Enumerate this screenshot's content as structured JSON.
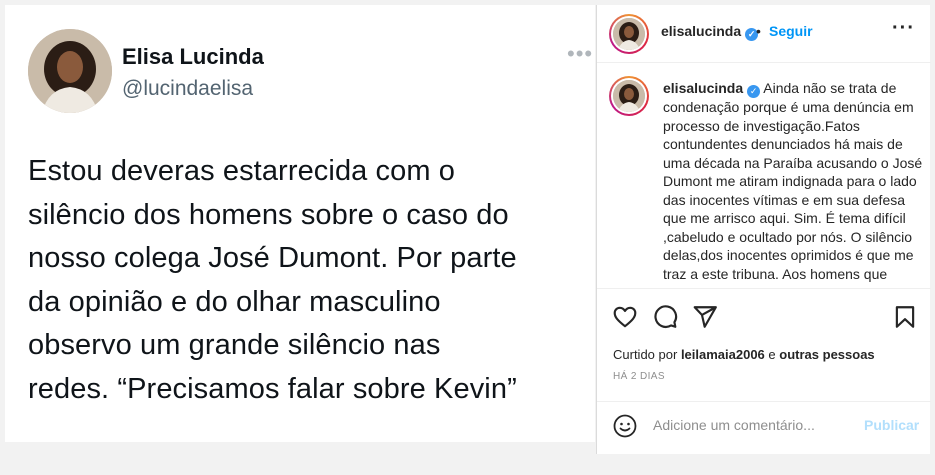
{
  "tweet": {
    "name": "Elisa Lucinda",
    "handle": "@lucindaelisa",
    "more_icon": "more-horizontal-icon",
    "lines": [
      "Estou deveras estarrecida com o",
      "silêncio dos homens sobre o caso do",
      "nosso colega José Dumont. Por parte",
      "da opinião e do olhar masculino",
      "observo um grande silêncio nas",
      "redes. “Precisamos falar sobre Kevin”"
    ]
  },
  "instagram": {
    "header": {
      "username": "elisalucinda",
      "separator": "•",
      "follow_label": "Seguir",
      "more_icon": "more-horizontal-icon"
    },
    "caption": {
      "username": "elisalucinda",
      "text": "Ainda não se trata de condenação porque é uma denúncia em processo de investigação.Fatos contundentes denunciados há mais de uma década na Paraíba acusando o José Dumont me atiram indignada para o lado das inocentes vítimas e em sua defesa que me arrisco aqui. Sim. É tema difícil ,cabeludo e ocultado por nós. O silêncio delas,dos inocentes oprimidos é que me traz a este tribuna. Aos homens que fazem"
    },
    "actions": {
      "like_icon": "heart-icon",
      "comment_icon": "comment-icon",
      "share_icon": "send-icon",
      "save_icon": "bookmark-icon"
    },
    "liked_by": {
      "prefix": "Curtido por",
      "user": "leilamaia2006",
      "connector": "e",
      "others": "outras pessoas"
    },
    "time_ago": "HÁ 2 DIAS",
    "comment": {
      "placeholder": "Adicione um comentário...",
      "publish_label": "Publicar",
      "emoji_icon": "smiley-icon"
    },
    "colors": {
      "link_blue": "#0095f6",
      "publish_disabled": "#b2dffc",
      "verified": "#3897f0"
    }
  }
}
